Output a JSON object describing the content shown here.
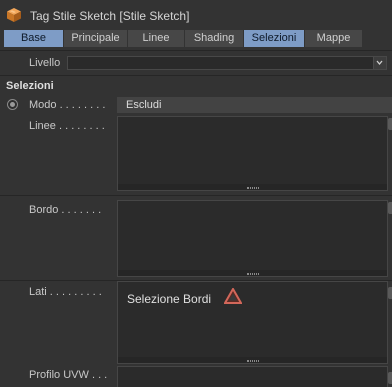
{
  "window": {
    "title": "Tag Stile Sketch [Stile Sketch]",
    "icon": "orange-cube-icon"
  },
  "tabs": [
    {
      "label": "Base",
      "active": true
    },
    {
      "label": "Principale",
      "active": false
    },
    {
      "label": "Linee",
      "active": false
    },
    {
      "label": "Shading",
      "active": false
    },
    {
      "label": "Selezioni",
      "active": true
    },
    {
      "label": "Mappe",
      "active": false
    }
  ],
  "livello": {
    "label": "Livello",
    "value": ""
  },
  "section": {
    "title": "Selezioni"
  },
  "modo": {
    "label": "Modo . . . . . . . .",
    "value": "Escludi"
  },
  "linee": {
    "label": "Linee . . . . . . . .",
    "items": []
  },
  "bordo": {
    "label": "Bordo . . . . . . .",
    "items": []
  },
  "lati": {
    "label": "Lati . . . . . . . . .",
    "items": [
      "Selezione Bordi"
    ]
  },
  "profilo": {
    "label": "Profilo UVW . . ."
  },
  "colors": {
    "background": "#333333",
    "tab_active": "#7e9cc6",
    "tab_inactive": "#474747",
    "warning": "#d2675a"
  }
}
